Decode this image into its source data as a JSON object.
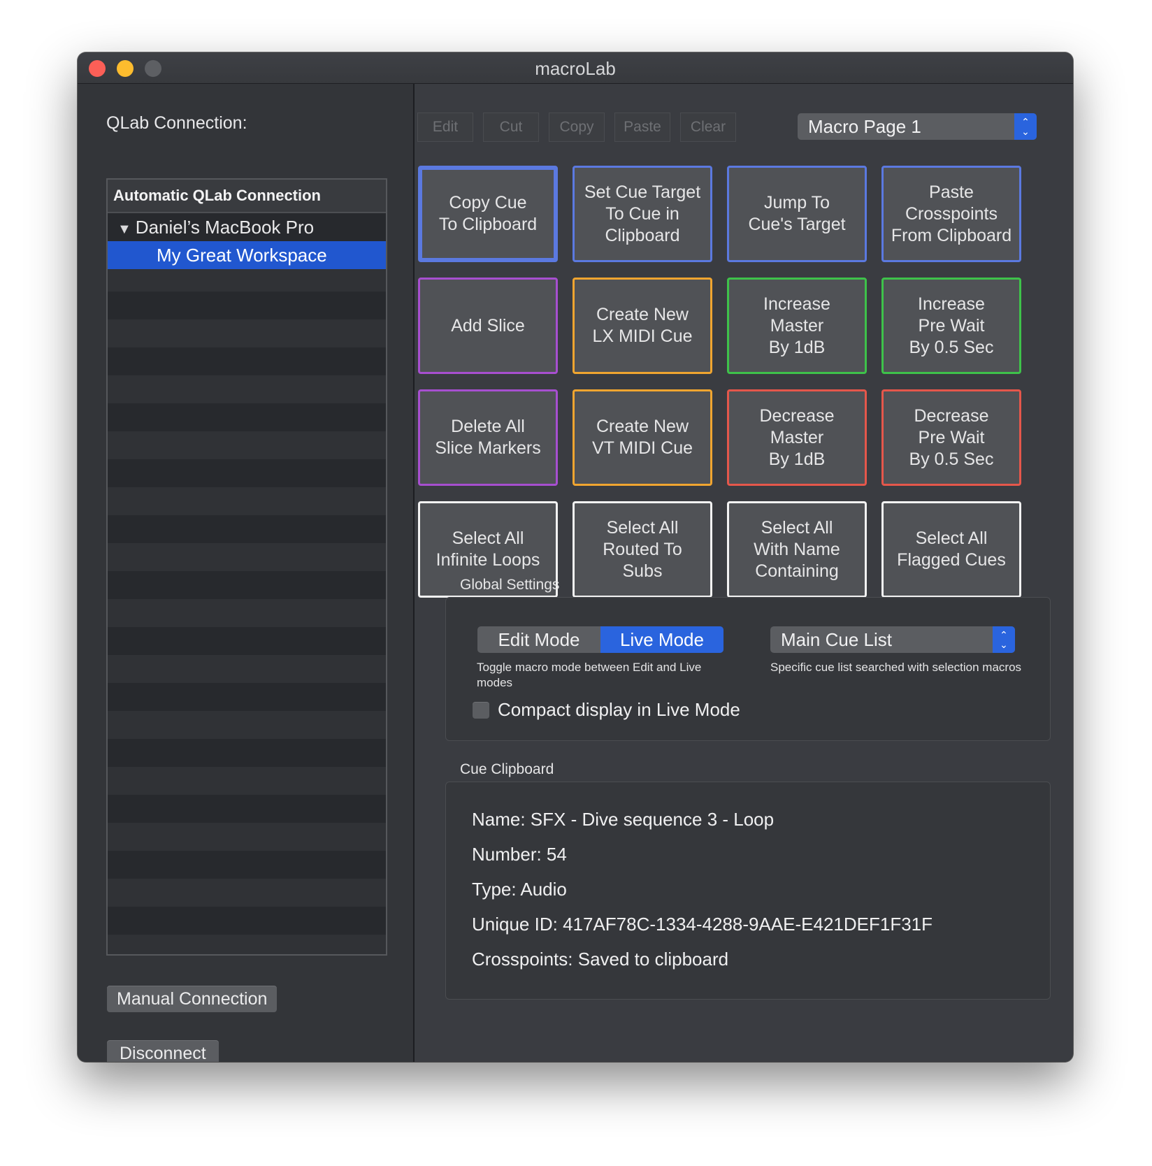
{
  "window": {
    "title": "macroLab"
  },
  "sidebar": {
    "label": "QLab Connection:",
    "table_header": "Automatic QLab Connection",
    "machine": "Daniel’s MacBook Pro",
    "workspace": "My Great Workspace",
    "manual_button": "Manual Connection",
    "disconnect_button": "Disconnect"
  },
  "toolbar": {
    "edit": "Edit",
    "cut": "Cut",
    "copy": "Copy",
    "paste": "Paste",
    "clear": "Clear",
    "page_select": "Macro Page 1"
  },
  "macros": [
    {
      "label": "Copy Cue\nTo Clipboard",
      "color": "#5b79e0"
    },
    {
      "label": "Set Cue Target\nTo Cue in\nClipboard",
      "color": "#5b79e0"
    },
    {
      "label": "Jump To\nCue's Target",
      "color": "#5b79e0"
    },
    {
      "label": "Paste\nCrosspoints\nFrom Clipboard",
      "color": "#5b79e0"
    },
    {
      "label": "Add Slice",
      "color": "#a74fd0"
    },
    {
      "label": "Create New\nLX MIDI Cue",
      "color": "#f0a530"
    },
    {
      "label": "Increase\nMaster\nBy 1dB",
      "color": "#3ec24a"
    },
    {
      "label": "Increase\nPre Wait\nBy 0.5 Sec",
      "color": "#3ec24a"
    },
    {
      "label": "Delete All\nSlice Markers",
      "color": "#a74fd0"
    },
    {
      "label": "Create New\nVT MIDI Cue",
      "color": "#f0a530"
    },
    {
      "label": "Decrease\nMaster\nBy 1dB",
      "color": "#e5574b"
    },
    {
      "label": "Decrease\nPre Wait\nBy 0.5 Sec",
      "color": "#e5574b"
    },
    {
      "label": "Select All\nInfinite Loops",
      "color": "#f2f2f2"
    },
    {
      "label": "Select All\nRouted To\nSubs",
      "color": "#f2f2f2"
    },
    {
      "label": "Select All\nWith Name\nContaining",
      "color": "#f2f2f2"
    },
    {
      "label": "Select All\nFlagged Cues",
      "color": "#f2f2f2"
    }
  ],
  "global_settings": {
    "title": "Global Settings",
    "mode_edit": "Edit Mode",
    "mode_live": "Live Mode",
    "mode_help": "Toggle macro mode between Edit and Live modes",
    "cue_list": "Main Cue List",
    "cue_list_help": "Specific cue list searched with selection macros",
    "compact_label": "Compact display in Live Mode"
  },
  "clipboard": {
    "title": "Cue Clipboard",
    "name": "Name: SFX - Dive sequence 3 - Loop",
    "number": "Number: 54",
    "type": "Type: Audio",
    "unique_id": "Unique ID: 417AF78C-1334-4288-9AAE-E421DEF1F31F",
    "crosspoints": "Crosspoints: Saved to clipboard"
  }
}
